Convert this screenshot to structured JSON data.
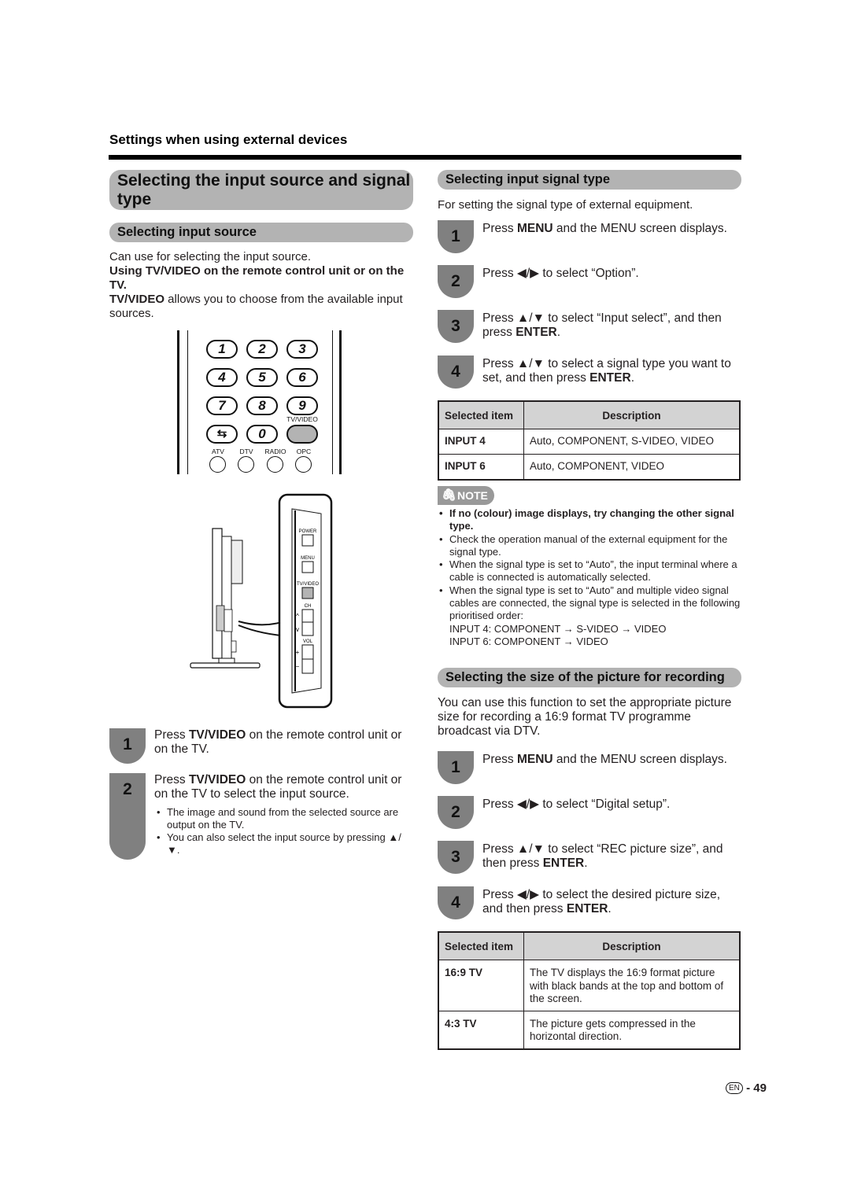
{
  "header": {
    "section_label": "Settings when using external devices"
  },
  "main_title": "Selecting the input source and signal type",
  "left": {
    "subheading": "Selecting input source",
    "intro": "Can use for selecting the input source.",
    "bold_line": "Using TV/VIDEO on the remote control unit or on the TV.",
    "tvvideo_bold": "TV/VIDEO",
    "tvvideo_rest": " allows you to choose from the available input sources.",
    "remote": {
      "buttons": [
        "1",
        "2",
        "3",
        "4",
        "5",
        "6",
        "7",
        "8",
        "9",
        "⇆",
        "0"
      ],
      "tvvideo_label": "TV/VIDEO",
      "bottom_labels": [
        "ATV",
        "DTV",
        "RADIO",
        "OPC"
      ]
    },
    "tv_panel": {
      "labels": [
        "POWER",
        "MENU",
        "TV/VIDEO",
        "CH",
        "VOL"
      ],
      "ch_up": "^",
      "ch_down": "v",
      "vol_plus": "+",
      "vol_minus": "−"
    },
    "steps": [
      {
        "num": "1",
        "pre": "Press ",
        "bold": "TV/VIDEO",
        "post": " on the remote control unit or on the TV.",
        "bullets": []
      },
      {
        "num": "2",
        "pre": "Press ",
        "bold": "TV/VIDEO",
        "post": " on the remote control unit or on the TV to select the input source.",
        "bullets": [
          "The image and sound from the selected source are output on the TV.",
          "You can also select the input source by pressing ▲/▼."
        ]
      }
    ]
  },
  "signal_type": {
    "subheading": "Selecting input signal type",
    "intro": "For setting the signal type of external equipment.",
    "steps": [
      {
        "num": "1",
        "pre": "Press ",
        "bold": "MENU",
        "post": " and the MENU screen displays."
      },
      {
        "num": "2",
        "pre": "Press ◀/▶ to select “Option”.",
        "bold": "",
        "post": ""
      },
      {
        "num": "3",
        "pre": "Press ▲/▼ to select “Input select”, and then press ",
        "bold": "ENTER",
        "post": "."
      },
      {
        "num": "4",
        "pre": "Press ▲/▼ to select a signal type you want to set, and then press ",
        "bold": "ENTER",
        "post": "."
      }
    ],
    "table": {
      "headers": [
        "Selected item",
        "Description"
      ],
      "rows": [
        [
          "INPUT 4",
          "Auto, COMPONENT, S-VIDEO, VIDEO"
        ],
        [
          "INPUT 6",
          "Auto, COMPONENT, VIDEO"
        ]
      ]
    },
    "note": {
      "badge": "NOTE",
      "items": [
        {
          "text": "If no (colour) image displays, try changing the other signal type.",
          "bold": true
        },
        {
          "text": "Check the operation manual of the external equipment for the signal type.",
          "bold": false
        },
        {
          "text": "When the signal type is set to “Auto”, the input terminal where a cable is connected is automatically selected.",
          "bold": false
        },
        {
          "text": "When the signal type is set to “Auto” and multiple video signal cables are connected, the signal type is selected in the following prioritised order:",
          "bold": false
        }
      ],
      "order_lines": [
        "INPUT 4: COMPONENT → S-VIDEO → VIDEO",
        "INPUT 6: COMPONENT → VIDEO"
      ]
    }
  },
  "rec_size": {
    "subheading": "Selecting the size of the picture for recording",
    "intro": "You can use this function to set the appropriate picture size for recording a 16:9 format TV programme broadcast via DTV.",
    "steps": [
      {
        "num": "1",
        "pre": "Press ",
        "bold": "MENU",
        "post": " and the MENU screen displays."
      },
      {
        "num": "2",
        "pre": "Press ◀/▶ to select “Digital setup”.",
        "bold": "",
        "post": ""
      },
      {
        "num": "3",
        "pre": "Press ▲/▼ to select “REC picture size”, and then press ",
        "bold": "ENTER",
        "post": "."
      },
      {
        "num": "4",
        "pre": "Press ◀/▶ to select the desired picture size, and then press ",
        "bold": "ENTER",
        "post": "."
      }
    ],
    "table": {
      "headers": [
        "Selected item",
        "Description"
      ],
      "rows": [
        [
          "16:9 TV",
          "The TV displays the 16:9 format picture with black bands at the top and bottom of the screen."
        ],
        [
          "4:3 TV",
          "The picture gets compressed in the horizontal direction."
        ]
      ]
    }
  },
  "footer": {
    "lang_badge": "EN",
    "page_number": "- 49"
  }
}
